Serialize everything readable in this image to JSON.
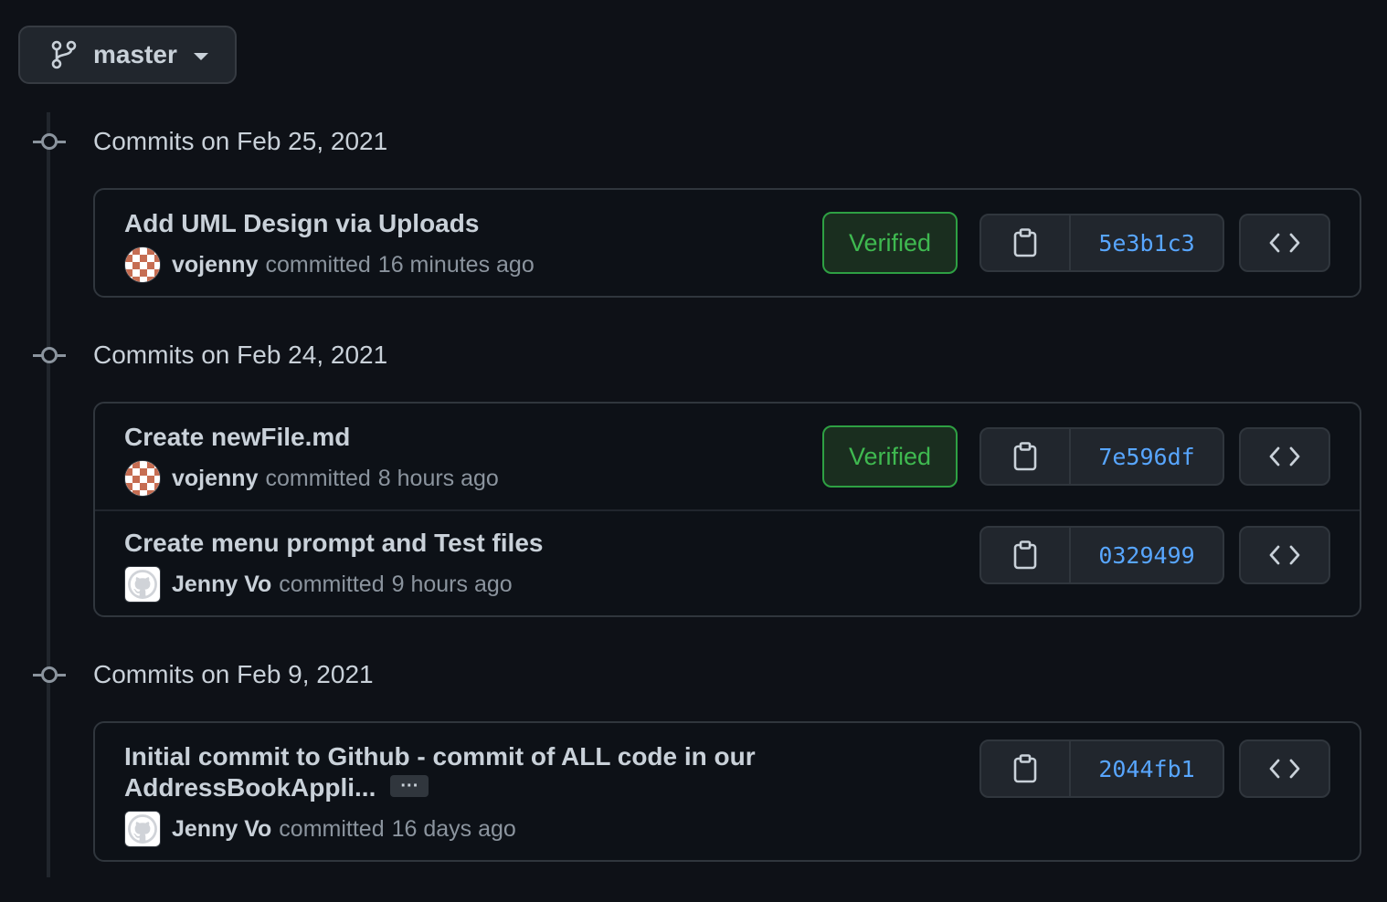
{
  "branch": {
    "name": "master",
    "icon": "git-branch-icon"
  },
  "groups": [
    {
      "date": "Commits on Feb 25, 2021",
      "commits": [
        {
          "title": "Add UML Design via Uploads",
          "author": "vojenny",
          "action": "committed",
          "when": "16 minutes ago",
          "avatar": "identicon-avatar",
          "verified": "Verified",
          "sha": "5e3b1c3"
        }
      ]
    },
    {
      "date": "Commits on Feb 24, 2021",
      "commits": [
        {
          "title": "Create newFile.md",
          "author": "vojenny",
          "action": "committed",
          "when": "8 hours ago",
          "avatar": "identicon-avatar",
          "verified": "Verified",
          "sha": "7e596df"
        },
        {
          "title": "Create menu prompt and Test files",
          "author": "Jenny Vo",
          "action": "committed",
          "when": "9 hours ago",
          "avatar": "github-default-avatar",
          "sha": "0329499"
        }
      ]
    },
    {
      "date": "Commits on Feb 9, 2021",
      "commits": [
        {
          "title_line1": "Initial commit to Github - commit of ALL code in our",
          "title_line2": "AddressBookAppli...",
          "ellipsis": "···",
          "author": "Jenny Vo",
          "action": "committed",
          "when": "16 days ago",
          "avatar": "github-default-avatar",
          "sha": "2044fb1"
        }
      ]
    }
  ],
  "icons": {
    "copy": "clipboard-icon",
    "browse": "code-icon",
    "node": "git-commit-icon"
  },
  "colors": {
    "background": "#0e1117",
    "link": "#58a6ff",
    "verified": "#3fb950",
    "muted": "#8b949e",
    "border": "#30363d"
  }
}
